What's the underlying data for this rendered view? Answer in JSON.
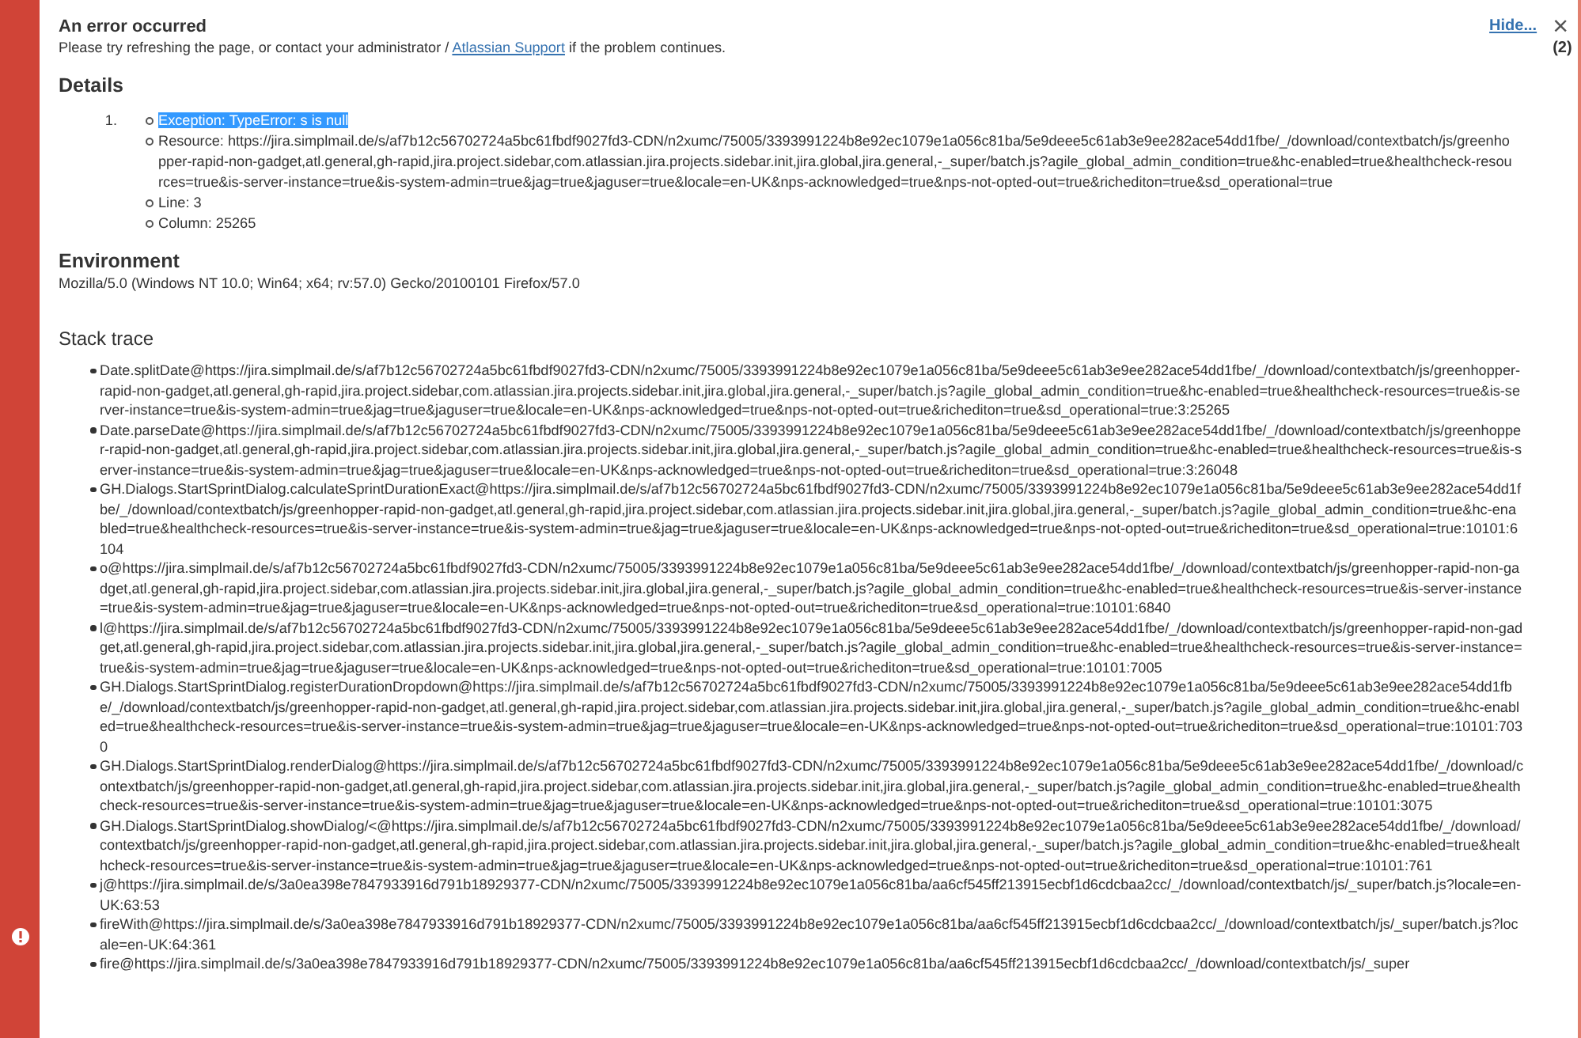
{
  "error": {
    "title": "An error occurred",
    "message_before": "Please try refreshing the page, or contact your administrator / ",
    "link": "Atlassian Support",
    "message_after": " if the problem continues.",
    "hide": "Hide...",
    "close": "×",
    "count": "(2)"
  },
  "details": {
    "heading": "Details",
    "number": "1.",
    "items": [
      {
        "text": "Exception: TypeError: s is null",
        "selected": true
      },
      {
        "text": "Resource: https://jira.simplmail.de/s/af7b12c56702724a5bc61fbdf9027fd3-CDN/n2xumc/75005/3393991224b8e92ec1079e1a056c81ba/5e9deee5c61ab3e9ee282ace54dd1fbe/_/download/contextbatch/js/greenhopper-rapid-non-gadget,atl.general,gh-rapid,jira.project.sidebar,com.atlassian.jira.projects.sidebar.init,jira.global,jira.general,-_super/batch.js?agile_global_admin_condition=true&hc-enabled=true&healthcheck-resources=true&is-server-instance=true&is-system-admin=true&jag=true&jaguser=true&locale=en-UK&nps-acknowledged=true&nps-not-opted-out=true&richediton=true&sd_operational=true",
        "selected": false
      },
      {
        "text": "Line: 3",
        "selected": false
      },
      {
        "text": "Column: 25265",
        "selected": false
      }
    ]
  },
  "environment": {
    "heading": "Environment",
    "text": "Mozilla/5.0 (Windows NT 10.0; Win64; x64; rv:57.0) Gecko/20100101 Firefox/57.0"
  },
  "stack_trace": {
    "heading": "Stack trace",
    "items": [
      "Date.splitDate@https://jira.simplmail.de/s/af7b12c56702724a5bc61fbdf9027fd3-CDN/n2xumc/75005/3393991224b8e92ec1079e1a056c81ba/5e9deee5c61ab3e9ee282ace54dd1fbe/_/download/contextbatch/js/greenhopper-rapid-non-gadget,atl.general,gh-rapid,jira.project.sidebar,com.atlassian.jira.projects.sidebar.init,jira.global,jira.general,-_super/batch.js?agile_global_admin_condition=true&hc-enabled=true&healthcheck-resources=true&is-server-instance=true&is-system-admin=true&jag=true&jaguser=true&locale=en-UK&nps-acknowledged=true&nps-not-opted-out=true&richediton=true&sd_operational=true:3:25265",
      "Date.parseDate@https://jira.simplmail.de/s/af7b12c56702724a5bc61fbdf9027fd3-CDN/n2xumc/75005/3393991224b8e92ec1079e1a056c81ba/5e9deee5c61ab3e9ee282ace54dd1fbe/_/download/contextbatch/js/greenhopper-rapid-non-gadget,atl.general,gh-rapid,jira.project.sidebar,com.atlassian.jira.projects.sidebar.init,jira.global,jira.general,-_super/batch.js?agile_global_admin_condition=true&hc-enabled=true&healthcheck-resources=true&is-server-instance=true&is-system-admin=true&jag=true&jaguser=true&locale=en-UK&nps-acknowledged=true&nps-not-opted-out=true&richediton=true&sd_operational=true:3:26048",
      "GH.Dialogs.StartSprintDialog.calculateSprintDurationExact@https://jira.simplmail.de/s/af7b12c56702724a5bc61fbdf9027fd3-CDN/n2xumc/75005/3393991224b8e92ec1079e1a056c81ba/5e9deee5c61ab3e9ee282ace54dd1fbe/_/download/contextbatch/js/greenhopper-rapid-non-gadget,atl.general,gh-rapid,jira.project.sidebar,com.atlassian.jira.projects.sidebar.init,jira.global,jira.general,-_super/batch.js?agile_global_admin_condition=true&hc-enabled=true&healthcheck-resources=true&is-server-instance=true&is-system-admin=true&jag=true&jaguser=true&locale=en-UK&nps-acknowledged=true&nps-not-opted-out=true&richediton=true&sd_operational=true:10101:6104",
      "o@https://jira.simplmail.de/s/af7b12c56702724a5bc61fbdf9027fd3-CDN/n2xumc/75005/3393991224b8e92ec1079e1a056c81ba/5e9deee5c61ab3e9ee282ace54dd1fbe/_/download/contextbatch/js/greenhopper-rapid-non-gadget,atl.general,gh-rapid,jira.project.sidebar,com.atlassian.jira.projects.sidebar.init,jira.global,jira.general,-_super/batch.js?agile_global_admin_condition=true&hc-enabled=true&healthcheck-resources=true&is-server-instance=true&is-system-admin=true&jag=true&jaguser=true&locale=en-UK&nps-acknowledged=true&nps-not-opted-out=true&richediton=true&sd_operational=true:10101:6840",
      "l@https://jira.simplmail.de/s/af7b12c56702724a5bc61fbdf9027fd3-CDN/n2xumc/75005/3393991224b8e92ec1079e1a056c81ba/5e9deee5c61ab3e9ee282ace54dd1fbe/_/download/contextbatch/js/greenhopper-rapid-non-gadget,atl.general,gh-rapid,jira.project.sidebar,com.atlassian.jira.projects.sidebar.init,jira.global,jira.general,-_super/batch.js?agile_global_admin_condition=true&hc-enabled=true&healthcheck-resources=true&is-server-instance=true&is-system-admin=true&jag=true&jaguser=true&locale=en-UK&nps-acknowledged=true&nps-not-opted-out=true&richediton=true&sd_operational=true:10101:7005",
      "GH.Dialogs.StartSprintDialog.registerDurationDropdown@https://jira.simplmail.de/s/af7b12c56702724a5bc61fbdf9027fd3-CDN/n2xumc/75005/3393991224b8e92ec1079e1a056c81ba/5e9deee5c61ab3e9ee282ace54dd1fbe/_/download/contextbatch/js/greenhopper-rapid-non-gadget,atl.general,gh-rapid,jira.project.sidebar,com.atlassian.jira.projects.sidebar.init,jira.global,jira.general,-_super/batch.js?agile_global_admin_condition=true&hc-enabled=true&healthcheck-resources=true&is-server-instance=true&is-system-admin=true&jag=true&jaguser=true&locale=en-UK&nps-acknowledged=true&nps-not-opted-out=true&richediton=true&sd_operational=true:10101:7030",
      "GH.Dialogs.StartSprintDialog.renderDialog@https://jira.simplmail.de/s/af7b12c56702724a5bc61fbdf9027fd3-CDN/n2xumc/75005/3393991224b8e92ec1079e1a056c81ba/5e9deee5c61ab3e9ee282ace54dd1fbe/_/download/contextbatch/js/greenhopper-rapid-non-gadget,atl.general,gh-rapid,jira.project.sidebar,com.atlassian.jira.projects.sidebar.init,jira.global,jira.general,-_super/batch.js?agile_global_admin_condition=true&hc-enabled=true&healthcheck-resources=true&is-server-instance=true&is-system-admin=true&jag=true&jaguser=true&locale=en-UK&nps-acknowledged=true&nps-not-opted-out=true&richediton=true&sd_operational=true:10101:3075",
      "GH.Dialogs.StartSprintDialog.showDialog/<@https://jira.simplmail.de/s/af7b12c56702724a5bc61fbdf9027fd3-CDN/n2xumc/75005/3393991224b8e92ec1079e1a056c81ba/5e9deee5c61ab3e9ee282ace54dd1fbe/_/download/contextbatch/js/greenhopper-rapid-non-gadget,atl.general,gh-rapid,jira.project.sidebar,com.atlassian.jira.projects.sidebar.init,jira.global,jira.general,-_super/batch.js?agile_global_admin_condition=true&hc-enabled=true&healthcheck-resources=true&is-server-instance=true&is-system-admin=true&jag=true&jaguser=true&locale=en-UK&nps-acknowledged=true&nps-not-opted-out=true&richediton=true&sd_operational=true:10101:761",
      "j@https://jira.simplmail.de/s/3a0ea398e7847933916d791b18929377-CDN/n2xumc/75005/3393991224b8e92ec1079e1a056c81ba/aa6cf545ff213915ecbf1d6cdcbaa2cc/_/download/contextbatch/js/_super/batch.js?locale=en-UK:63:53",
      "fireWith@https://jira.simplmail.de/s/3a0ea398e7847933916d791b18929377-CDN/n2xumc/75005/3393991224b8e92ec1079e1a056c81ba/aa6cf545ff213915ecbf1d6cdcbaa2cc/_/download/contextbatch/js/_super/batch.js?locale=en-UK:64:361",
      "fire@https://jira.simplmail.de/s/3a0ea398e7847933916d791b18929377-CDN/n2xumc/75005/3393991224b8e92ec1079e1a056c81ba/aa6cf545ff213915ecbf1d6cdcbaa2cc/_/download/contextbatch/js/_super"
    ]
  }
}
